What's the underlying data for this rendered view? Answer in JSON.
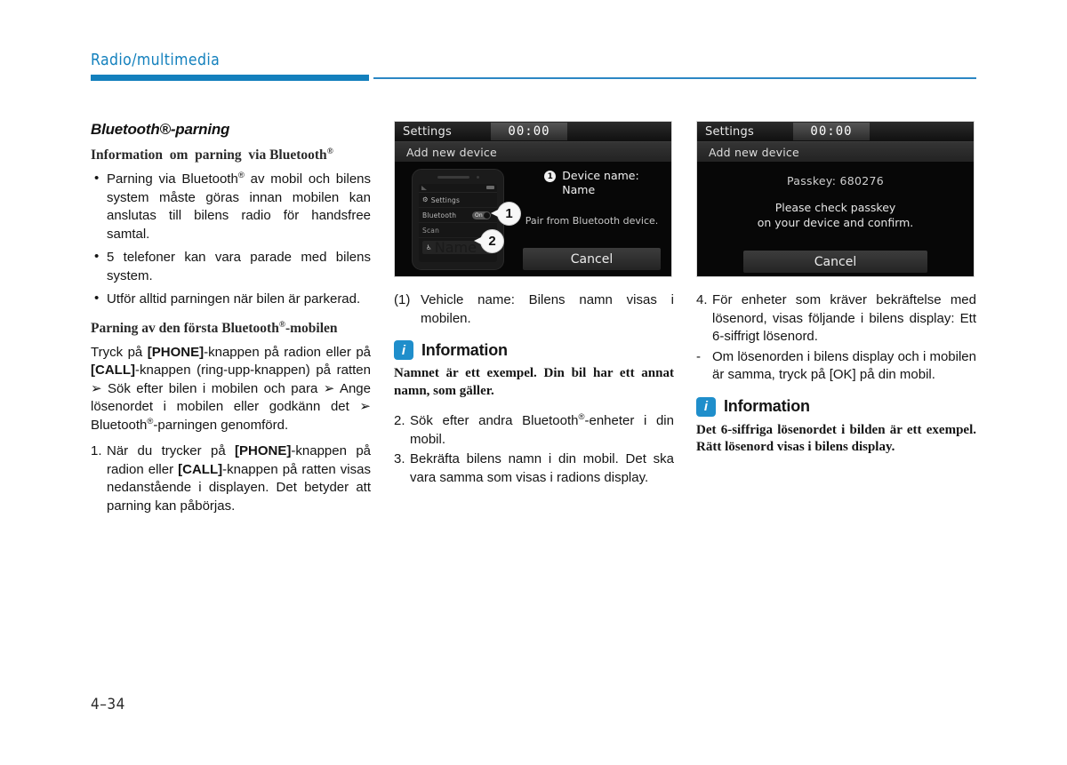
{
  "header": {
    "chapter_title": "Radio/multimedia",
    "accent_color": "#1380bd"
  },
  "footer": {
    "page_number": "4–34"
  },
  "left_column": {
    "section_title": "Bluetooth®-parning",
    "subhead_1": "Information om parning via Bluetooth®",
    "bullets": [
      "Parning via Bluetooth® av mobil och bilens system måste göras innan mobilen kan anslutas till bilens radio för handsfree samtal.",
      "5 telefoner kan vara parade med bilens system.",
      "Utför alltid parningen när bilen är parkerad."
    ],
    "subhead_2": "Parning av den första Bluetooth®-mobilen",
    "intro_paragraph": "Tryck på [PHONE]-knappen på radion eller på [CALL]-knappen (ring-upp-knappen) på ratten ➜ Sök efter bilen i mobilen och para ➜ Ange lösenordet i mobilen eller godkänn det ➜ Bluetooth®-parningen genomförd.",
    "step_1": {
      "marker": "1.",
      "text": "När du trycker på [PHONE]-knappen på radion eller [CALL]-knappen på ratten visas nedanstående i displayen. Det betyder att parning kan påbörjas."
    }
  },
  "middle_column": {
    "device_screenshot": {
      "title": "Settings",
      "clock": "00:00",
      "subtitle": "Add new device",
      "phone_mock": {
        "settings_label": "Settings",
        "bluetooth_label": "Bluetooth",
        "toggle_value": "On",
        "scan_label": "Scan",
        "device_label": "Name"
      },
      "callout_1": "1",
      "callout_2": "2",
      "badge_1": "1",
      "device_name_label": "Device name:",
      "device_name_value": "Name",
      "pair_note": "Pair from Bluetooth device.",
      "cancel_label": "Cancel"
    },
    "caption": {
      "marker": "(1)",
      "text": "Vehicle name: Bilens namn visas i mobilen."
    },
    "info": {
      "icon": "info-icon",
      "title": "Information",
      "body": "Namnet är ett exempel. Din bil har ett annat namn, som gäller."
    },
    "step_2": {
      "marker": "2.",
      "text": "Sök efter andra Bluetooth®-enheter i din mobil."
    },
    "step_3": {
      "marker": "3.",
      "text": "Bekräfta bilens namn i din mobil. Det ska vara samma som visas i radions display."
    }
  },
  "right_column": {
    "device_screenshot": {
      "title": "Settings",
      "clock": "00:00",
      "subtitle": "Add new device",
      "passkey_label": "Passkey: 680276",
      "message_line_1": "Please check passkey",
      "message_line_2": "on your device and confirm.",
      "cancel_label": "Cancel"
    },
    "step_4": {
      "marker": "4.",
      "text": "För enheter som kräver bekräftelse med lösenord, visas följande i bilens display: Ett 6-siffrigt lösenord."
    },
    "sub_step": {
      "marker": "-",
      "text": "Om lösenorden i bilens display och i mobilen är samma, tryck på [OK] på din mobil."
    },
    "info": {
      "icon": "info-icon",
      "title": "Information",
      "body": "Det 6-siffriga lösenordet i bilden är ett exempel. Rätt lösenord visas i bilens display."
    }
  }
}
